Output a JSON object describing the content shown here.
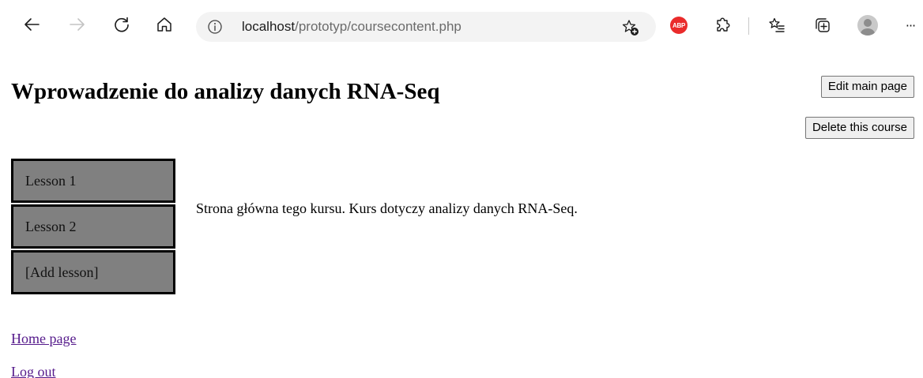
{
  "browser": {
    "url_host": "localhost",
    "url_path": "/prototyp/coursecontent.php",
    "icons": {
      "back": "back-arrow-icon",
      "forward": "forward-arrow-icon",
      "reload": "reload-icon",
      "home": "home-icon",
      "site_info": "info-icon",
      "add_favorite": "star-plus-icon",
      "adblock": "adblock-plus-icon",
      "extensions": "puzzle-icon",
      "favorites": "favorites-list-icon",
      "collections": "collections-icon",
      "profile": "profile-avatar",
      "menu": "more-dots-icon"
    },
    "adblock_label": "ABP",
    "menu_label": "···",
    "adblock_color": "#ea2b2b"
  },
  "page": {
    "title": "Wprowadzenie do analizy danych RNA-Seq",
    "buttons": {
      "edit_main_page": "Edit main page",
      "delete_course": "Delete this course"
    },
    "lessons": [
      {
        "label": "Lesson 1"
      },
      {
        "label": "Lesson 2"
      },
      {
        "label": "[Add lesson]"
      }
    ],
    "description": "Strona główna tego kursu. Kurs dotyczy analizy danych RNA-Seq.",
    "links": {
      "home": "Home page",
      "logout": "Log out"
    }
  },
  "colors": {
    "lesson_bg": "#808080",
    "lesson_border": "#000000",
    "visited_link": "#551a8b",
    "button_bg": "#efefef"
  }
}
